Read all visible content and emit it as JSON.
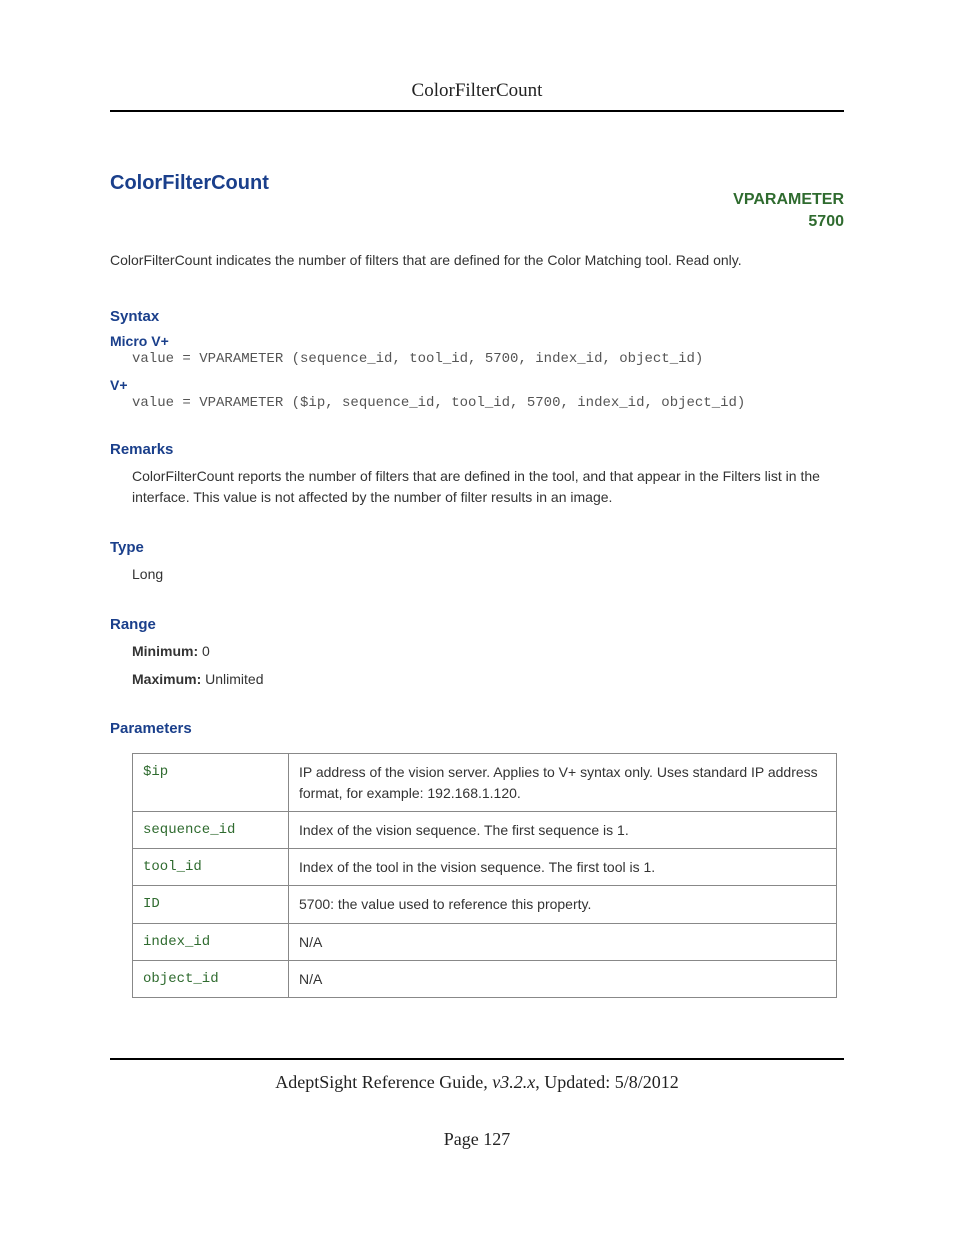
{
  "header": {
    "title": "ColorFilterCount"
  },
  "title": "ColorFilterCount",
  "vparameter": {
    "label": "VPARAMETER",
    "code": "5700"
  },
  "intro": "ColorFilterCount indicates the number of filters that are defined for the Color Matching tool. Read only.",
  "syntax": {
    "heading": "Syntax",
    "micro_label": "Micro V+",
    "micro_code": "value = VPARAMETER (sequence_id, tool_id, 5700, index_id, object_id)",
    "vplus_label": "V+",
    "vplus_code": "value = VPARAMETER ($ip, sequence_id, tool_id, 5700, index_id, object_id)"
  },
  "remarks": {
    "heading": "Remarks",
    "text": "ColorFilterCount reports the number of filters that are defined in the tool, and that appear in the Filters list in the interface. This value is not affected by the number of filter results in an image."
  },
  "type": {
    "heading": "Type",
    "value": "Long"
  },
  "range": {
    "heading": "Range",
    "min_label": "Minimum:",
    "min_value": " 0",
    "max_label": "Maximum:",
    "max_value": " Unlimited"
  },
  "parameters": {
    "heading": "Parameters",
    "rows": [
      {
        "name": "$ip",
        "desc": "IP address of the vision server. Applies to V+ syntax only. Uses standard IP address format, for example: 192.168.1.120."
      },
      {
        "name": "sequence_id",
        "desc": "Index of the vision sequence. The first sequence is 1."
      },
      {
        "name": "tool_id",
        "desc": "Index of the tool in the vision sequence. The first tool is 1."
      },
      {
        "name": "ID",
        "desc": "5700: the value used to reference this property."
      },
      {
        "name": "index_id",
        "desc": "N/A"
      },
      {
        "name": "object_id",
        "desc": "N/A"
      }
    ]
  },
  "footer": {
    "guide": "AdeptSight Reference Guide",
    "version": ", v3.2.x",
    "updated": ", Updated: 5/8/2012",
    "page": "Page 127"
  }
}
